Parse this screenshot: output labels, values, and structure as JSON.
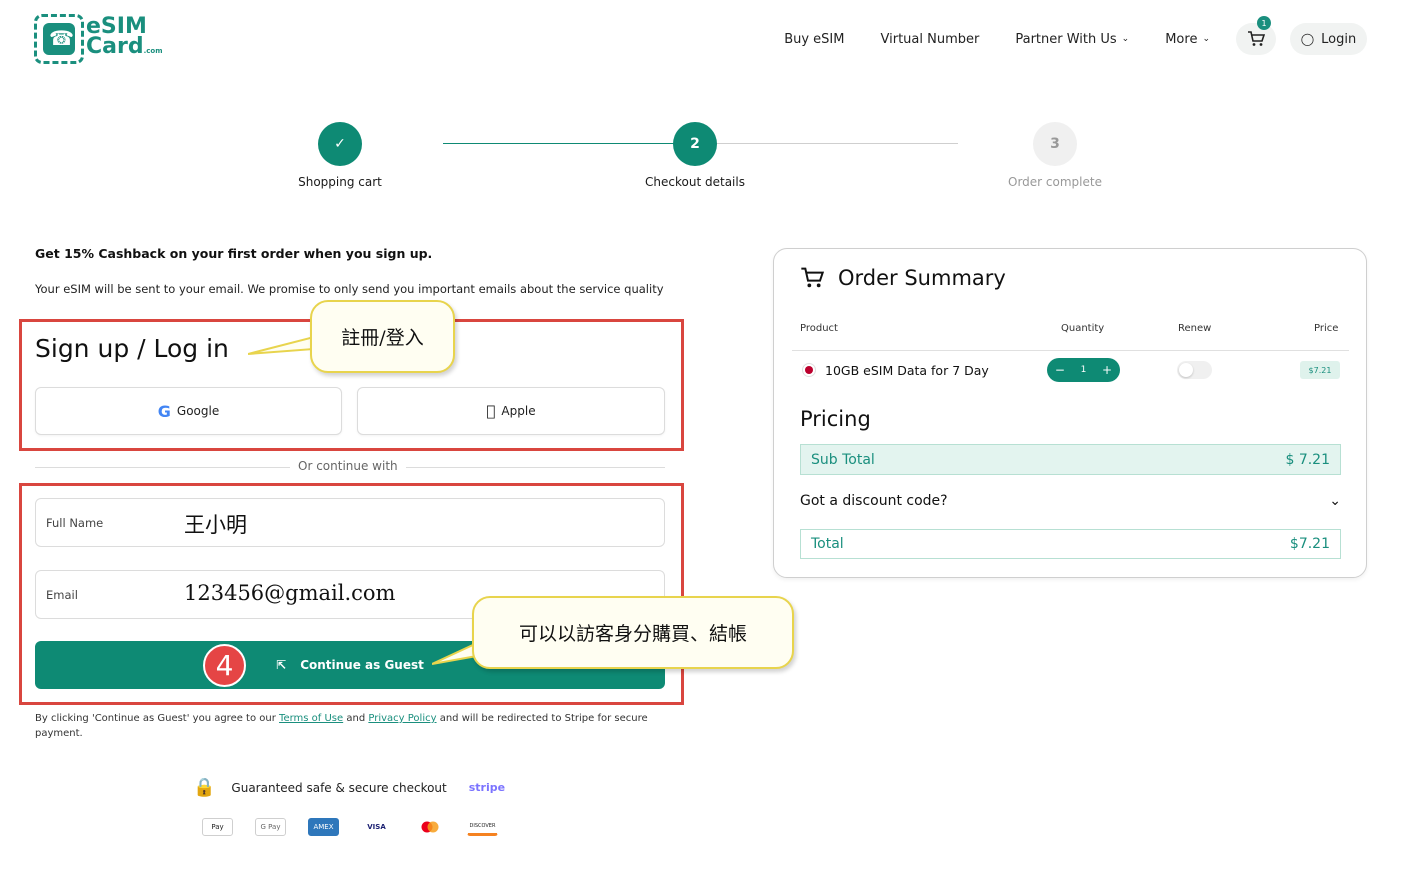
{
  "header": {
    "logo_line1": "eSIM",
    "logo_line2": "Card",
    "logo_suffix": ".com",
    "nav": [
      "Buy eSIM",
      "Virtual Number",
      "Partner With Us",
      "More"
    ],
    "cart_count": "1",
    "login_label": "Login"
  },
  "stepper": {
    "steps": [
      {
        "label": "Shopping cart",
        "marker": "✓",
        "state": "done"
      },
      {
        "label": "Checkout details",
        "marker": "2",
        "state": "active"
      },
      {
        "label": "Order complete",
        "marker": "3",
        "state": "pending"
      }
    ],
    "colors": {
      "accent": "#0e8a74",
      "pending": "#f0f0f0"
    }
  },
  "checkout": {
    "promo": "Get 15% Cashback on your first order when you sign up.",
    "notice": "Your eSIM will be sent to your email. We promise to only send you important emails about the service quality",
    "signup_title": "Sign up / Log in",
    "google_label": "Google",
    "apple_label": "Apple",
    "divider_text": "Or continue with",
    "full_name_label": "Full Name",
    "full_name_value": "王小明",
    "email_label": "Email",
    "email_value": "123456@gmail.com",
    "guest_button": "Continue as Guest",
    "legal_prefix": "By clicking 'Continue as Guest' you agree to our",
    "terms_link": "Terms of Use",
    "legal_and": "and",
    "privacy_link": "Privacy Policy",
    "legal_suffix": "and will be redirected to Stripe for secure payment.",
    "secure_text": "Guaranteed safe & secure checkout",
    "stripe_label": "stripe",
    "payments": [
      "Pay",
      "G Pay",
      "AMEX",
      "VISA",
      "",
      "DISCOVER"
    ]
  },
  "annotations": {
    "callout_signup": "註冊/登入",
    "callout_guest": "可以以訪客身分購買、結帳",
    "step_number": "4",
    "highlight_color": "#d9463f"
  },
  "order_summary": {
    "title": "Order Summary",
    "col_product": "Product",
    "col_quantity": "Quantity",
    "col_renew": "Renew",
    "col_price": "Price",
    "product_name": "10GB eSIM Data for 7 Day",
    "quantity": "1",
    "price": "$7.21",
    "pricing_title": "Pricing",
    "sub_total_label": "Sub Total",
    "sub_total_value": "$ 7.21",
    "discount_label": "Got a discount code?",
    "total_label": "Total",
    "total_value": "$7.21"
  }
}
